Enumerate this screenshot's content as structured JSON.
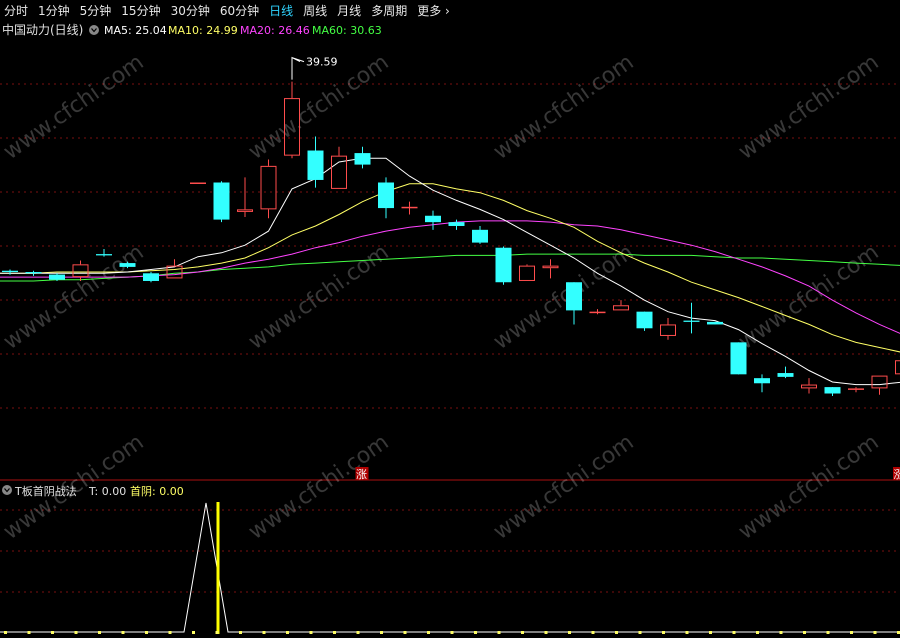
{
  "toolbar": {
    "items": [
      "分时",
      "1分钟",
      "5分钟",
      "15分钟",
      "30分钟",
      "60分钟",
      "日线",
      "周线",
      "月线",
      "多周期",
      "更多"
    ],
    "active_index": 6,
    "more_icon": "chevron-right-icon"
  },
  "main_panel": {
    "title": "中国动力(日线)",
    "collapse_icon": "circle-chevron-down-icon",
    "ma": [
      {
        "label": "MA5: 25.04",
        "color": "#ffffff"
      },
      {
        "label": "MA10: 24.99",
        "color": "#ffff66"
      },
      {
        "label": "MA20: 26.46",
        "color": "#ff44ff"
      },
      {
        "label": "MA60: 30.63",
        "color": "#44ff44"
      }
    ],
    "high_annotation": "39.59",
    "limit_up_badge": "涨",
    "limit_up_badge_right": "涨"
  },
  "sub_panel": {
    "title": "T板首阴战法",
    "collapse_icon": "circle-chevron-down-icon",
    "t_label": "T: 0.00",
    "first_yin_label": "首阴: 0.00"
  },
  "watermark": "www.cfchi.com",
  "colors": {
    "up": "#ff4d4d",
    "down": "#33ffff",
    "grid": "#7a1010",
    "signal": "#ffff00",
    "axis_red": "#aa1111"
  },
  "chart_data": {
    "type": "candlestick",
    "ohlc": [
      [
        24.8,
        24.9,
        24.5,
        24.7
      ],
      [
        24.7,
        24.8,
        24.4,
        24.6
      ],
      [
        24.5,
        24.6,
        24.0,
        24.1
      ],
      [
        24.3,
        25.6,
        24.0,
        25.3
      ],
      [
        26.1,
        26.5,
        25.9,
        26.0
      ],
      [
        25.4,
        25.5,
        25.0,
        25.1
      ],
      [
        24.6,
        24.7,
        23.9,
        24.0
      ],
      [
        24.2,
        25.7,
        24.2,
        25.2
      ],
      [
        31.7,
        31.7,
        31.7,
        31.7
      ],
      [
        31.7,
        31.8,
        28.6,
        28.8
      ],
      [
        29.4,
        32.1,
        29.0,
        29.6
      ],
      [
        29.6,
        33.5,
        28.9,
        33.0
      ],
      [
        33.8,
        39.59,
        33.6,
        38.3
      ],
      [
        34.2,
        35.3,
        31.3,
        31.9
      ],
      [
        31.2,
        34.5,
        31.2,
        33.8
      ],
      [
        34.0,
        34.5,
        32.8,
        33.1
      ],
      [
        31.7,
        32.1,
        28.9,
        29.7
      ],
      [
        29.8,
        30.2,
        29.2,
        29.8
      ],
      [
        29.1,
        29.5,
        28.0,
        28.6
      ],
      [
        28.6,
        28.8,
        28.0,
        28.3
      ],
      [
        28.0,
        28.3,
        26.9,
        27.0
      ],
      [
        26.6,
        26.7,
        23.7,
        23.9
      ],
      [
        24.0,
        25.3,
        24.0,
        25.2
      ],
      [
        25.0,
        25.7,
        24.2,
        25.2
      ],
      [
        23.9,
        23.9,
        20.6,
        21.7
      ],
      [
        21.6,
        21.8,
        21.4,
        21.6
      ],
      [
        21.7,
        22.5,
        21.7,
        22.1
      ],
      [
        21.6,
        21.6,
        20.1,
        20.3
      ],
      [
        19.7,
        21.1,
        19.4,
        20.6
      ],
      [
        20.9,
        22.3,
        19.9,
        20.8
      ],
      [
        20.8,
        20.8,
        20.6,
        20.6
      ],
      [
        19.2,
        19.2,
        16.7,
        16.7
      ],
      [
        16.4,
        16.7,
        15.3,
        16.0
      ],
      [
        16.8,
        17.3,
        16.4,
        16.5
      ],
      [
        15.6,
        16.4,
        15.2,
        15.9
      ],
      [
        15.7,
        15.7,
        15.0,
        15.2
      ],
      [
        15.5,
        15.7,
        15.3,
        15.6
      ],
      [
        15.6,
        16.6,
        15.1,
        16.6
      ],
      [
        16.7,
        18.1,
        16.7,
        17.8
      ],
      [
        16.9,
        17.0,
        16.5,
        16.6
      ]
    ],
    "ma5": [
      24.6,
      24.6,
      24.6,
      24.6,
      24.6,
      24.7,
      24.9,
      25.1,
      25.9,
      26.2,
      26.8,
      27.9,
      31.2,
      32.0,
      33.3,
      33.6,
      33.6,
      32.2,
      31.1,
      30.3,
      29.6,
      28.8,
      27.8,
      26.8,
      25.8,
      24.6,
      23.6,
      22.5,
      21.6,
      21.1,
      20.9,
      20.2,
      19.1,
      18.1,
      17.0,
      16.1,
      15.9,
      15.9,
      16.1,
      16.4
    ],
    "ma10": [
      24.6,
      24.6,
      24.7,
      24.7,
      24.7,
      24.7,
      24.8,
      24.9,
      25.1,
      25.4,
      25.8,
      26.6,
      27.6,
      28.3,
      29.2,
      30.2,
      31.0,
      31.6,
      31.6,
      31.2,
      30.9,
      30.3,
      29.5,
      28.9,
      28.2,
      27.1,
      26.2,
      25.4,
      24.7,
      23.9,
      23.3,
      22.7,
      22.0,
      21.3,
      20.6,
      19.8,
      19.2,
      18.8,
      18.4,
      18.1
    ],
    "ma20": [
      24.3,
      24.3,
      24.3,
      24.3,
      24.3,
      24.3,
      24.4,
      24.5,
      24.7,
      25.0,
      25.4,
      25.7,
      26.1,
      26.6,
      27.0,
      27.5,
      27.9,
      28.2,
      28.4,
      28.6,
      28.7,
      28.7,
      28.7,
      28.6,
      28.4,
      28.3,
      28.0,
      27.6,
      27.2,
      26.8,
      26.3,
      25.7,
      25.1,
      24.4,
      23.6,
      22.5,
      21.5,
      20.6,
      19.8,
      19.0
    ],
    "ma60": [
      24.0,
      24.0,
      24.1,
      24.1,
      24.2,
      24.3,
      24.4,
      24.6,
      24.7,
      24.9,
      25.0,
      25.1,
      25.3,
      25.4,
      25.5,
      25.6,
      25.7,
      25.8,
      25.9,
      26.0,
      26.0,
      26.0,
      26.1,
      26.1,
      26.1,
      26.1,
      26.1,
      26.0,
      26.0,
      26.0,
      25.9,
      25.8,
      25.8,
      25.7,
      25.6,
      25.5,
      25.4,
      25.3,
      25.2,
      25.1
    ],
    "ylim": [
      10.0,
      43.0
    ],
    "indicator": {
      "series": "T",
      "spike_index": 8,
      "signal_index": 9
    }
  }
}
